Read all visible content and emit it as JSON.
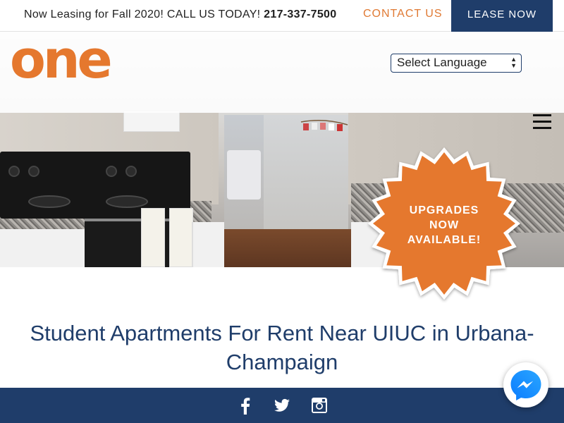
{
  "topbar": {
    "leasing_text": "Now Leasing for Fall 2020! CALL US TODAY! ",
    "phone": "217-337-7500",
    "contact_label": "CONTACT US",
    "lease_label": "LEASE NOW"
  },
  "brand": {
    "logo_text": "one",
    "accent_color": "#e5782e",
    "navy_color": "#1f3d6a"
  },
  "language": {
    "selected": "Select Language"
  },
  "menu": {
    "icon": "hamburger-menu-icon"
  },
  "badge": {
    "line1": "UPGRADES",
    "line2": "NOW",
    "line3": "AVAILABLE!"
  },
  "headline": {
    "line1": "Student Apartments For Rent Near UIUC in Urbana-",
    "line2": "Champaign"
  },
  "social": {
    "icons": [
      "facebook-icon",
      "twitter-icon",
      "instagram-icon"
    ]
  },
  "chat": {
    "icon": "messenger-icon"
  }
}
